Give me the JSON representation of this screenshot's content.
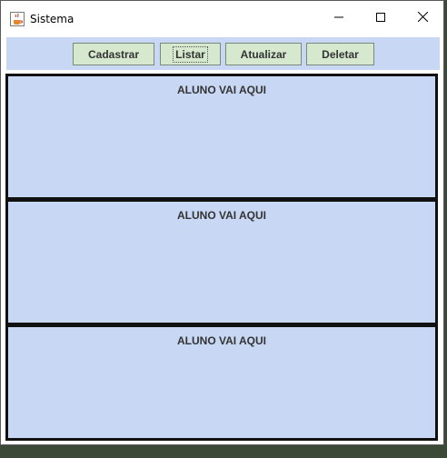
{
  "window": {
    "title": "Sistema"
  },
  "toolbar": {
    "buttons": [
      {
        "label": "Cadastrar"
      },
      {
        "label": "Listar"
      },
      {
        "label": "Atualizar"
      },
      {
        "label": "Deletar"
      }
    ]
  },
  "panels": [
    {
      "label": "ALUNO VAI AQUI"
    },
    {
      "label": "ALUNO VAI AQUI"
    },
    {
      "label": "ALUNO VAI AQUI"
    }
  ],
  "colors": {
    "panel_bg": "#c8d8f4",
    "button_bg": "#d6e9cf",
    "panel_border": "#111111"
  },
  "icons": {
    "app": "java-cup-icon",
    "minimize": "minimize-icon",
    "maximize": "maximize-icon",
    "close": "close-icon"
  }
}
